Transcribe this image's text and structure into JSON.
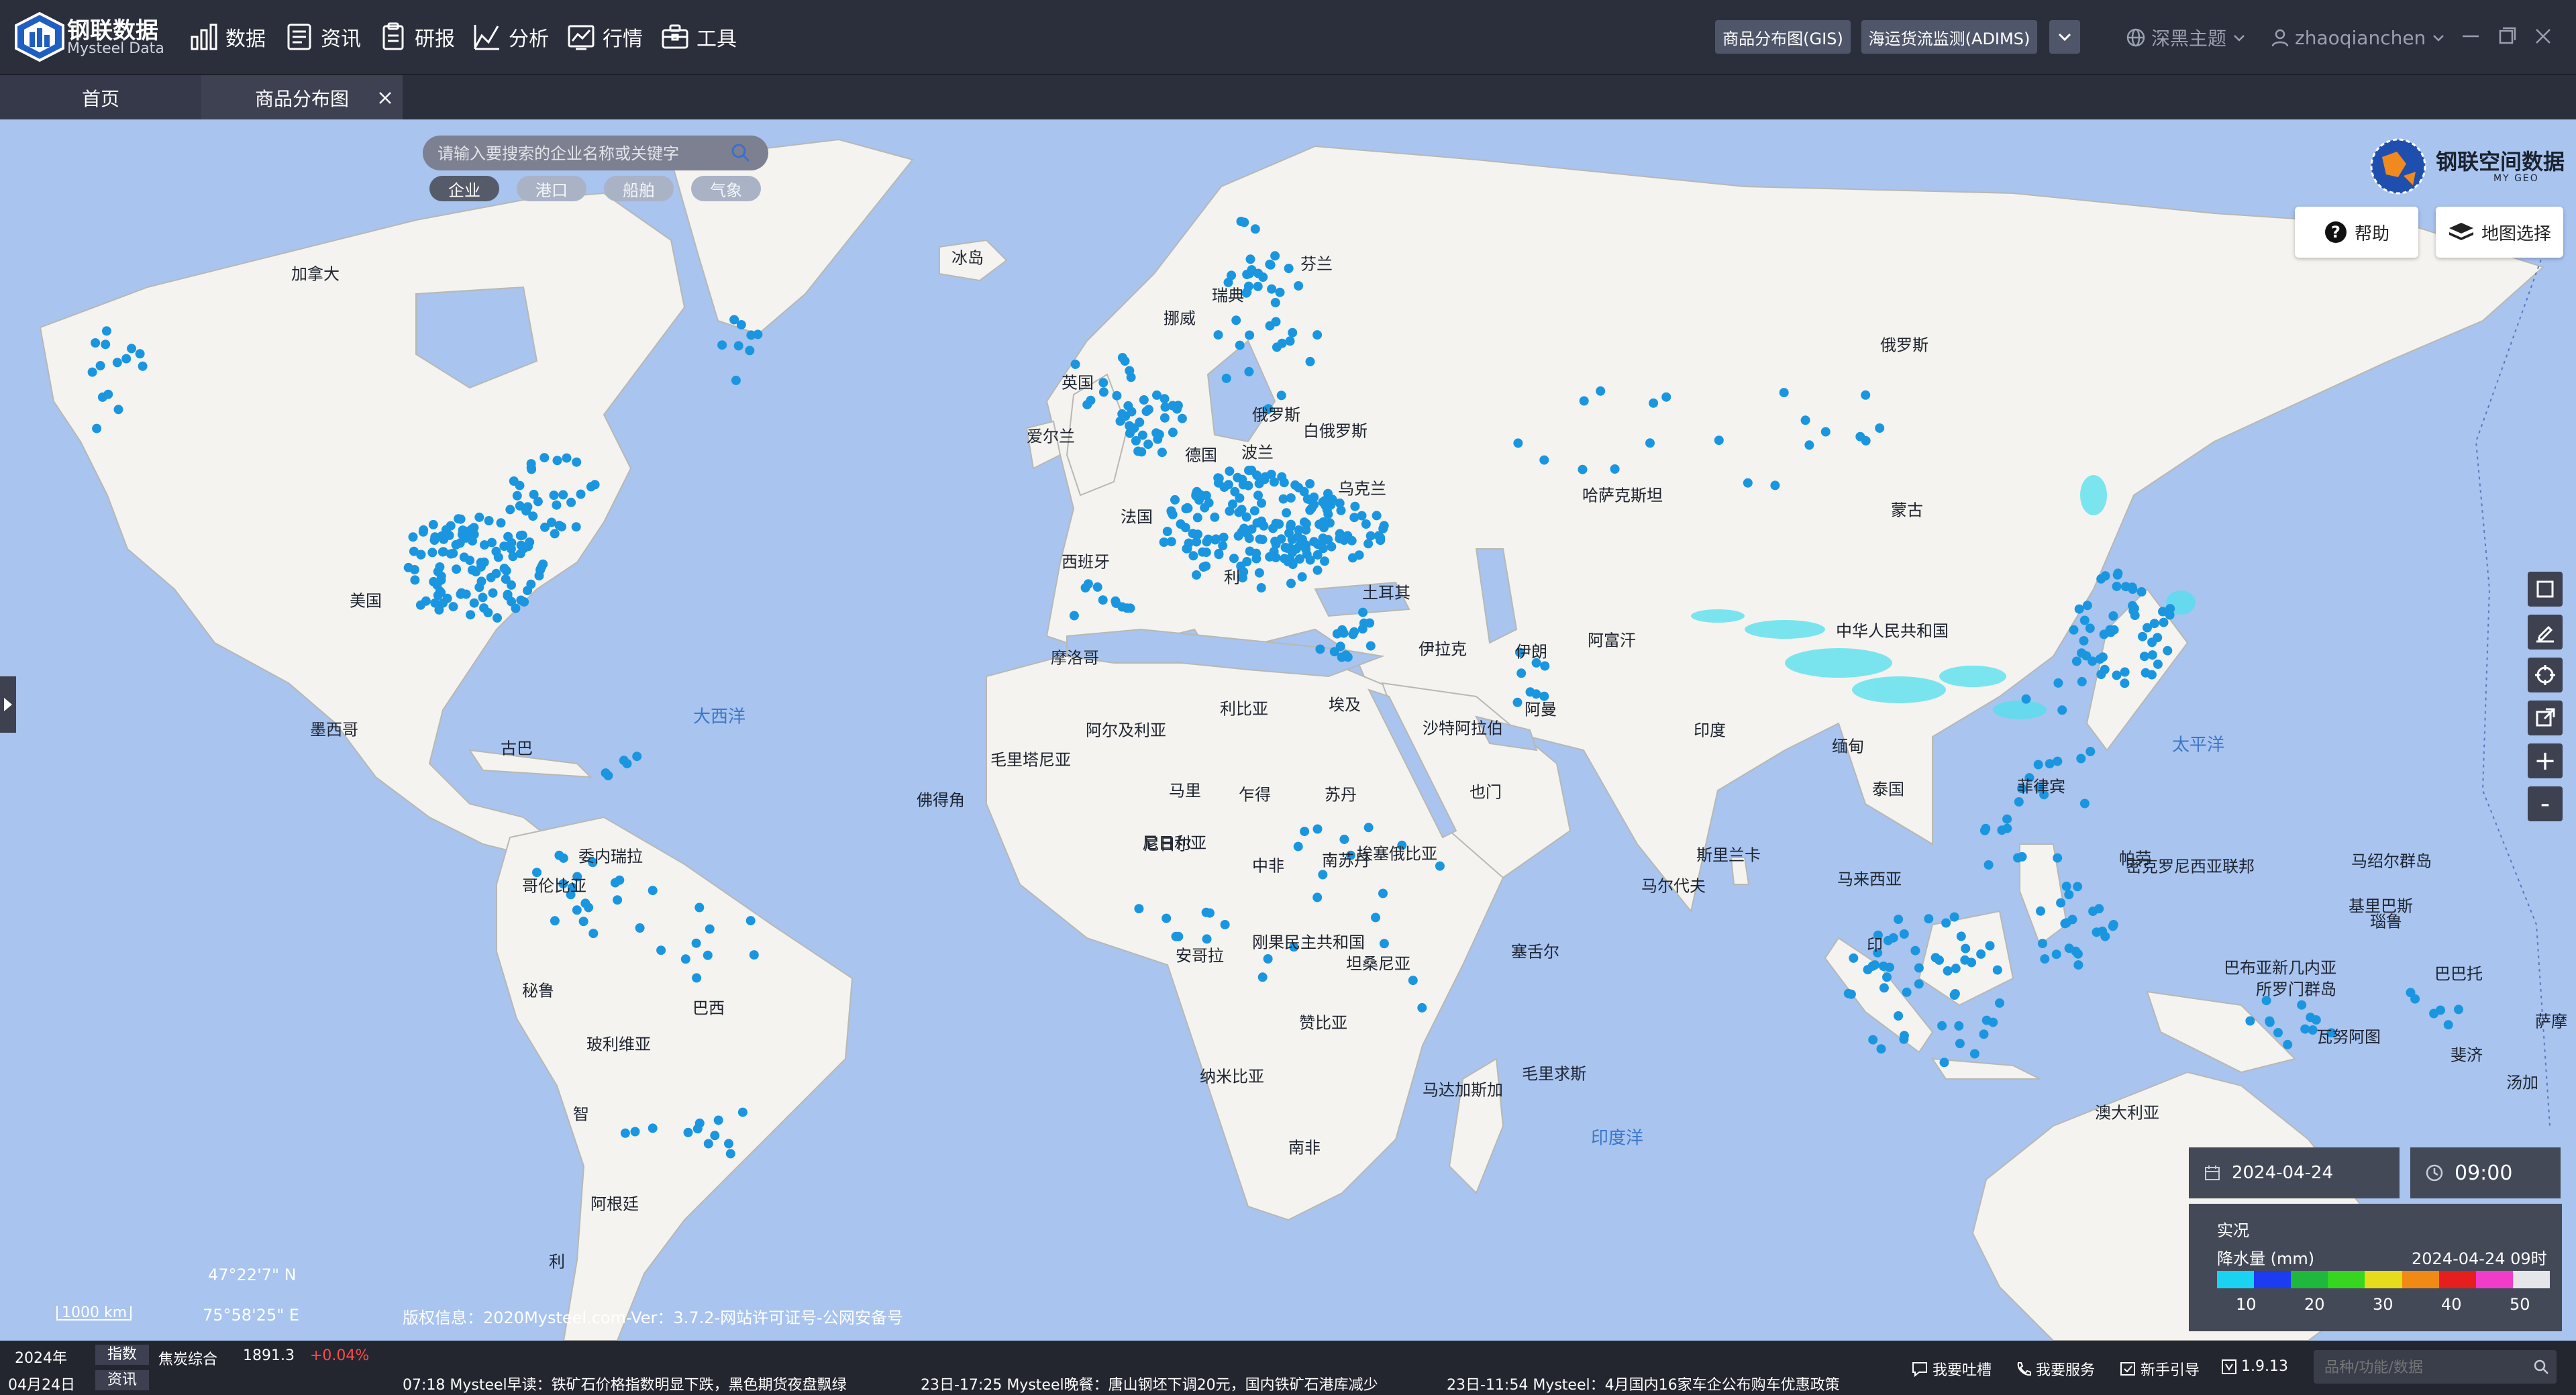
{
  "header": {
    "brand_cn": "钢联数据",
    "brand_en": "Mysteel Data",
    "nav": [
      {
        "label": "数据",
        "icon": "bar-chart-icon"
      },
      {
        "label": "资讯",
        "icon": "document-icon"
      },
      {
        "label": "研报",
        "icon": "report-icon"
      },
      {
        "label": "分析",
        "icon": "analysis-icon"
      },
      {
        "label": "行情",
        "icon": "market-icon"
      },
      {
        "label": "工具",
        "icon": "toolbox-icon"
      }
    ],
    "btn_gis": "商品分布图(GIS)",
    "btn_adims": "海运货流监测(ADIMS)",
    "theme": "深黑主题",
    "user": "zhaoqianchen"
  },
  "tabs": [
    {
      "label": "首页"
    },
    {
      "label": "商品分布图"
    }
  ],
  "search": {
    "placeholder": "请输入要搜索的企业名称或关键字",
    "chips": [
      "企业",
      "港口",
      "船舶",
      "气象"
    ],
    "active_chip": "企业"
  },
  "geo_brand": {
    "name": "钢联空间数据",
    "sub": "MY GEO"
  },
  "panel": {
    "help": "帮助",
    "map_select": "地图选择"
  },
  "map_labels": {
    "countries": [
      {
        "t": "加拿大"
      },
      {
        "t": "美国"
      },
      {
        "t": "墨西哥"
      },
      {
        "t": "古巴"
      },
      {
        "t": "委内瑞拉"
      },
      {
        "t": "哥伦比亚"
      },
      {
        "t": "秘鲁"
      },
      {
        "t": "巴西"
      },
      {
        "t": "玻利维亚"
      },
      {
        "t": "智"
      },
      {
        "t": "阿根廷"
      },
      {
        "t": "利"
      },
      {
        "t": "冰岛"
      },
      {
        "t": "瑞典"
      },
      {
        "t": "芬兰"
      },
      {
        "t": "挪威"
      },
      {
        "t": "英国"
      },
      {
        "t": "爱尔兰"
      },
      {
        "t": "德国"
      },
      {
        "t": "波兰"
      },
      {
        "t": "俄罗斯"
      },
      {
        "t": "白俄罗斯"
      },
      {
        "t": "乌克兰"
      },
      {
        "t": "法国"
      },
      {
        "t": "西班牙"
      },
      {
        "t": "利"
      },
      {
        "t": "土耳其"
      },
      {
        "t": "摩洛哥"
      },
      {
        "t": "阿尔及利亚"
      },
      {
        "t": "利比亚"
      },
      {
        "t": "埃及"
      },
      {
        "t": "毛里塔尼亚"
      },
      {
        "t": "马里"
      },
      {
        "t": "尼日尔"
      },
      {
        "t": "乍得"
      },
      {
        "t": "苏丹"
      },
      {
        "t": "尼日利亚"
      },
      {
        "t": "佛得角"
      },
      {
        "t": "中非"
      },
      {
        "t": "南苏丹"
      },
      {
        "t": "埃塞俄比亚"
      },
      {
        "t": "刚果民主共和国"
      },
      {
        "t": "安哥拉"
      },
      {
        "t": "坦桑尼亚"
      },
      {
        "t": "赞比亚"
      },
      {
        "t": "纳米比亚"
      },
      {
        "t": "南非"
      },
      {
        "t": "马达加斯加"
      },
      {
        "t": "毛里求斯"
      },
      {
        "t": "塞舌尔"
      },
      {
        "t": "伊拉克"
      },
      {
        "t": "伊朗"
      },
      {
        "t": "沙特阿拉伯"
      },
      {
        "t": "阿曼"
      },
      {
        "t": "也门"
      },
      {
        "t": "阿富汗"
      },
      {
        "t": "哈萨克斯坦"
      },
      {
        "t": "俄罗斯"
      },
      {
        "t": "蒙古"
      },
      {
        "t": "中华人民共和国"
      },
      {
        "t": "印度"
      },
      {
        "t": "缅甸"
      },
      {
        "t": "泰国"
      },
      {
        "t": "斯里兰卡"
      },
      {
        "t": "马尔代夫"
      },
      {
        "t": "马来西亚"
      },
      {
        "t": "菲律宾"
      },
      {
        "t": "印"
      },
      {
        "t": "帕劳"
      },
      {
        "t": "密克罗尼西亚联邦"
      },
      {
        "t": "马绍尔群岛"
      },
      {
        "t": "基里巴斯"
      },
      {
        "t": "瑙鲁"
      },
      {
        "t": "巴布亚新几内亚"
      },
      {
        "t": "所罗门群岛"
      },
      {
        "t": "巴巴托"
      },
      {
        "t": "瓦努阿图"
      },
      {
        "t": "斐济"
      },
      {
        "t": "汤加"
      },
      {
        "t": "萨摩"
      },
      {
        "t": "澳大利亚"
      }
    ],
    "oceans": [
      {
        "t": "大西洋"
      },
      {
        "t": "太平洋"
      },
      {
        "t": "印度洋"
      }
    ]
  },
  "tools": [
    {
      "name": "select-box-tool",
      "icon": "square-icon"
    },
    {
      "name": "draw-tool",
      "icon": "pencil-icon"
    },
    {
      "name": "locate-tool",
      "icon": "crosshair-icon"
    },
    {
      "name": "export-tool",
      "icon": "export-icon"
    },
    {
      "name": "zoom-in-button",
      "label": "+"
    },
    {
      "name": "zoom-out-button",
      "label": "-"
    }
  ],
  "datetime": {
    "date": "2024-04-24",
    "time": "09:00"
  },
  "legend": {
    "title": "实况",
    "metric": "降水量 (mm)",
    "stamp": "2024-04-24 09时",
    "ticks": [
      "10",
      "20",
      "30",
      "40",
      "50"
    ],
    "colors": [
      "#19d3f0",
      "#1b3cf0",
      "#1fb83c",
      "#36d620",
      "#e6dc1c",
      "#f08a14",
      "#e61e1e",
      "#f03cc8",
      "#e4e6ea"
    ]
  },
  "scale": "1000 km",
  "coords": {
    "lat": "47°22'7\" N",
    "lon": "75°58'25\" E"
  },
  "copyright": "版权信息：2020Mysteel.com-Ver：3.7.2-网站许可证号-公网安备号",
  "status": {
    "year": "2024年",
    "day": "04月24日",
    "tag_index": "指数",
    "index_name": "焦炭综合",
    "index_value": "1891.3",
    "index_change": "+0.04%",
    "tag_news": "资讯",
    "news": [
      "07:18  Mysteel早读：铁矿石价格指数明显下跌，黑色期货夜盘飘绿",
      "23日-17:25  Mysteel晚餐：唐山钢坯下调20元，国内铁矿石港库减少",
      "23日-11:54  Mysteel：4月国内16家车企公布购车优惠政策"
    ],
    "feedback": "我要吐槽",
    "service": "我要服务",
    "guide": "新手引导",
    "version": "1.9.13",
    "search_placeholder": "品种/功能/数据"
  },
  "colors": {
    "dot": "#1a96e0",
    "land": "#f4f3ef",
    "ocean": "#a8c4ef",
    "border": "#b8b8b4",
    "rain": "#52e0ee",
    "bar": "#2b2e3b"
  }
}
